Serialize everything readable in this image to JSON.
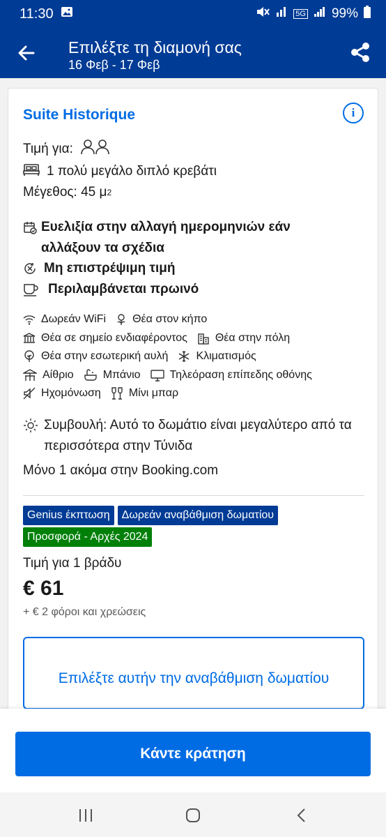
{
  "status_bar": {
    "time": "11:30",
    "network": "5G",
    "battery": "99%"
  },
  "header": {
    "title": "Επιλέξτε τη διαμονή σας",
    "dates": "16 Φεβ - 17 Φεβ"
  },
  "room": {
    "name": "Suite Historique",
    "price_for_label": "Τιμή για:",
    "bed": "1 πολύ μεγάλο διπλό κρεβάτι",
    "size_label": "Μέγεθος: 45 μ",
    "size_exp": "2",
    "policies": {
      "flexible": "Ευελιξία στην αλλαγή ημερομηνιών εάν αλλάξουν τα σχέδια",
      "non_refundable": "Μη επιστρέψιμη τιμή",
      "breakfast": "Περιλαμβάνεται πρωινό"
    },
    "facilities": {
      "wifi": "Δωρεάν WiFi",
      "garden_view": "Θέα στον κήπο",
      "landmark_view": "Θέα σε σημείο ενδιαφέροντος",
      "city_view": "Θέα στην πόλη",
      "courtyard_view": "Θέα στην εσωτερική αυλή",
      "ac": "Κλιματισμός",
      "patio": "Αίθριο",
      "bath": "Μπάνιο",
      "tv": "Τηλεόραση επίπεδης οθόνης",
      "soundproof": "Ηχομόνωση",
      "minibar": "Μίνι μπαρ"
    },
    "tip": "Συμβουλή: Αυτό το δωμάτιο είναι μεγαλύτερο από τα περισσότερα στην Τύνιδα",
    "availability": "Μόνο 1 ακόμα στην Booking.com",
    "badges": {
      "genius": "Genius έκπτωση",
      "upgrade": "Δωρεάν αναβάθμιση δωματίου",
      "deal": "Προσφορά - Αρχές 2024"
    },
    "price_label": "Τιμή για 1 βράδυ",
    "price": "€ 61",
    "taxes": "+ € 2 φόροι και χρεώσεις",
    "upgrade_button": "Επιλέξτε αυτήν την αναβάθμιση δωματίου"
  },
  "book_button": "Κάντε κράτηση",
  "colors": {
    "brand_dark": "#003b95",
    "brand_blue": "#006ce4",
    "deal_green": "#008009"
  },
  "icons": [
    "back-arrow-icon",
    "share-icon",
    "info-icon",
    "people-icon",
    "bed-icon",
    "calendar-check-icon",
    "circle-x-icon",
    "cup-icon",
    "wifi-icon",
    "flower-icon",
    "landmark-icon",
    "city-icon",
    "tree-icon",
    "snowflake-icon",
    "patio-icon",
    "bath-icon",
    "tv-icon",
    "mute-icon",
    "glasses-icon",
    "lightbulb-icon"
  ]
}
